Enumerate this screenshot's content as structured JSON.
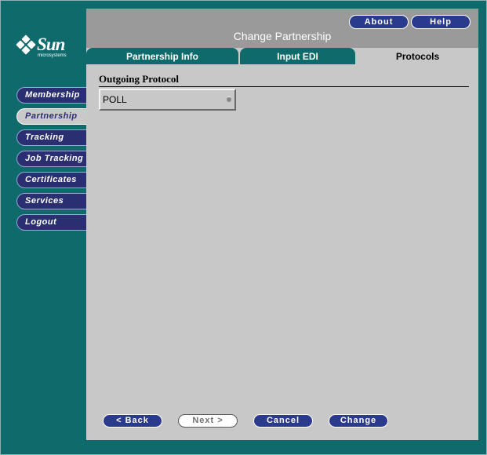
{
  "brand": {
    "name": "Sun",
    "tagline": "microsystems"
  },
  "header": {
    "about_label": "About",
    "help_label": "Help",
    "title": "Change Partnership"
  },
  "tabs": [
    {
      "label": "Partnership Info",
      "active": false
    },
    {
      "label": "Input EDI",
      "active": false
    },
    {
      "label": "Protocols",
      "active": true
    }
  ],
  "sidebar": {
    "items": [
      {
        "label": "Membership",
        "active": false
      },
      {
        "label": "Partnership",
        "active": true
      },
      {
        "label": "Tracking",
        "active": false
      },
      {
        "label": "Job Tracking",
        "active": false
      },
      {
        "label": "Certificates",
        "active": false
      },
      {
        "label": "Services",
        "active": false
      },
      {
        "label": "Logout",
        "active": false
      }
    ]
  },
  "form": {
    "section_title": "Outgoing Protocol",
    "protocol_value": "POLL"
  },
  "buttons": {
    "back_label": "< Back",
    "next_label": "Next >",
    "cancel_label": "Cancel",
    "change_label": "Change"
  },
  "colors": {
    "background": "#0f6b6b",
    "panel": "#c8c8c8",
    "header": "#9a9a9a",
    "nav_button": "#2a2f72",
    "action_button": "#2a3a8c"
  }
}
